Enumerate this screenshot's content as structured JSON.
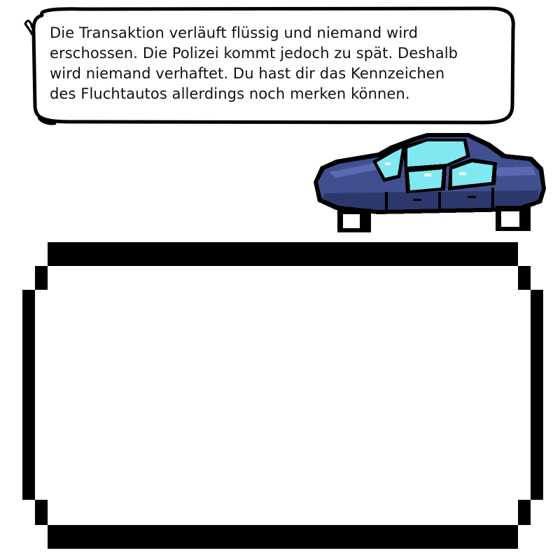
{
  "story": {
    "text": "Die Transaktion verläuft flüssig und niemand wird\nerschossen. Die Polizei kommt jedoch zu spät. Deshalb\nwird niemand verhaftet. Du hast dir das Kennzeichen\ndes Fluchtautos allerdings noch merken können."
  },
  "scene": {
    "sprite": "getaway-car",
    "car_body_color": "#3f4f8f",
    "car_window_color": "#7fe8f0",
    "outline_color": "#000000"
  },
  "choice_panel": {
    "options": []
  }
}
